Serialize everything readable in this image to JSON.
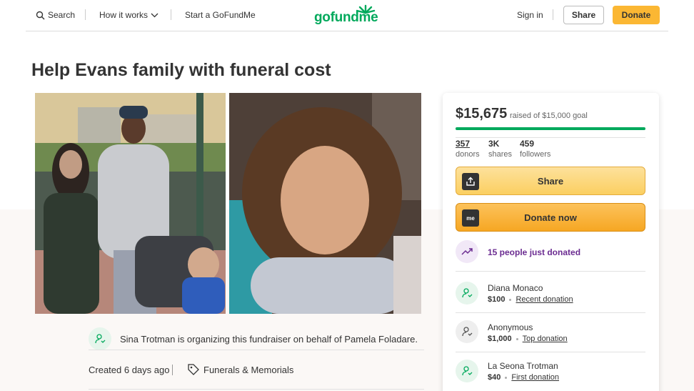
{
  "header": {
    "search_label": "Search",
    "how_it_works_label": "How it works",
    "start_label": "Start a GoFundMe",
    "logo_text": "gofundme",
    "sign_in_label": "Sign in",
    "share_label": "Share",
    "donate_label": "Donate"
  },
  "page": {
    "title": "Help Evans family with funeral cost",
    "organizer_text": "Sina Trotman is organizing this fundraiser on behalf of Pamela Foladare.",
    "created": "Created 6 days ago",
    "category": "Funerals & Memorials"
  },
  "sidebar": {
    "raised": "$15,675",
    "raised_of": "raised of $15,000 goal",
    "progress_fraction": 1.0,
    "stats": [
      {
        "value": "357",
        "label": "donors"
      },
      {
        "value": "3K",
        "label": "shares"
      },
      {
        "value": "459",
        "label": "followers"
      }
    ],
    "share_button": "Share",
    "donate_button": "Donate now",
    "donate_icon_text": "me",
    "recent_text": "15 people just donated",
    "donations": [
      {
        "name": "Diana Monaco",
        "amount": "$100",
        "kind": "Recent donation"
      },
      {
        "name": "Anonymous",
        "amount": "$1,000",
        "kind": "Top donation"
      },
      {
        "name": "La Seona Trotman",
        "amount": "$40",
        "kind": "First donation"
      }
    ]
  },
  "colors": {
    "brand_green": "#02a95c",
    "donate_yellow": "#fbb733",
    "purple": "#6b2c91"
  }
}
